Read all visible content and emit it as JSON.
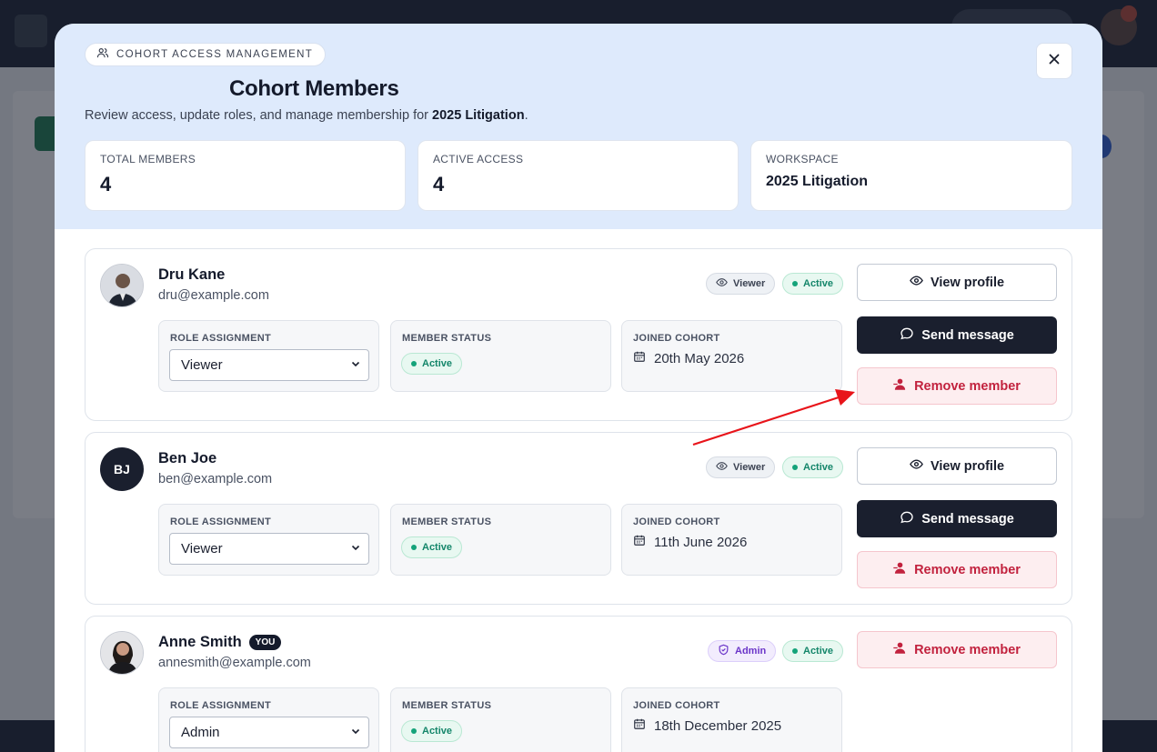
{
  "header": {
    "eyebrow": "COHORT ACCESS MANAGEMENT",
    "title": "Cohort Members",
    "subtitle_prefix": "Review access, update roles, and manage membership for ",
    "subtitle_workspace": "2025 Litigation",
    "subtitle_suffix": "."
  },
  "stats": [
    {
      "label": "TOTAL MEMBERS",
      "value": "4"
    },
    {
      "label": "ACTIVE ACCESS",
      "value": "4"
    },
    {
      "label": "WORKSPACE",
      "value": "2025 Litigation"
    }
  ],
  "labels": {
    "role": "ROLE ASSIGNMENT",
    "status": "MEMBER STATUS",
    "joined": "JOINED COHORT",
    "view_profile": "View profile",
    "send_message": "Send message",
    "remove_member": "Remove member"
  },
  "members": [
    {
      "name": "Dru Kane",
      "email": "dru@example.com",
      "role_badge": "Viewer",
      "status_badge": "Active",
      "role": "Viewer",
      "status": "Active",
      "joined": "20th May 2026"
    },
    {
      "name": "Ben Joe",
      "initials": "BJ",
      "email": "ben@example.com",
      "role_badge": "Viewer",
      "status_badge": "Active",
      "role": "Viewer",
      "status": "Active",
      "joined": "11th June 2026"
    },
    {
      "name": "Anne Smith",
      "you_tag": "YOU",
      "email": "annesmith@example.com",
      "role_badge": "Admin",
      "status_badge": "Active",
      "role": "Admin",
      "status": "Active",
      "joined": "18th December 2025"
    }
  ],
  "colors": {
    "accent_dark": "#1a1f2e",
    "danger": "#c2223e",
    "success": "#14866a",
    "header_bg": "#deeafc"
  }
}
